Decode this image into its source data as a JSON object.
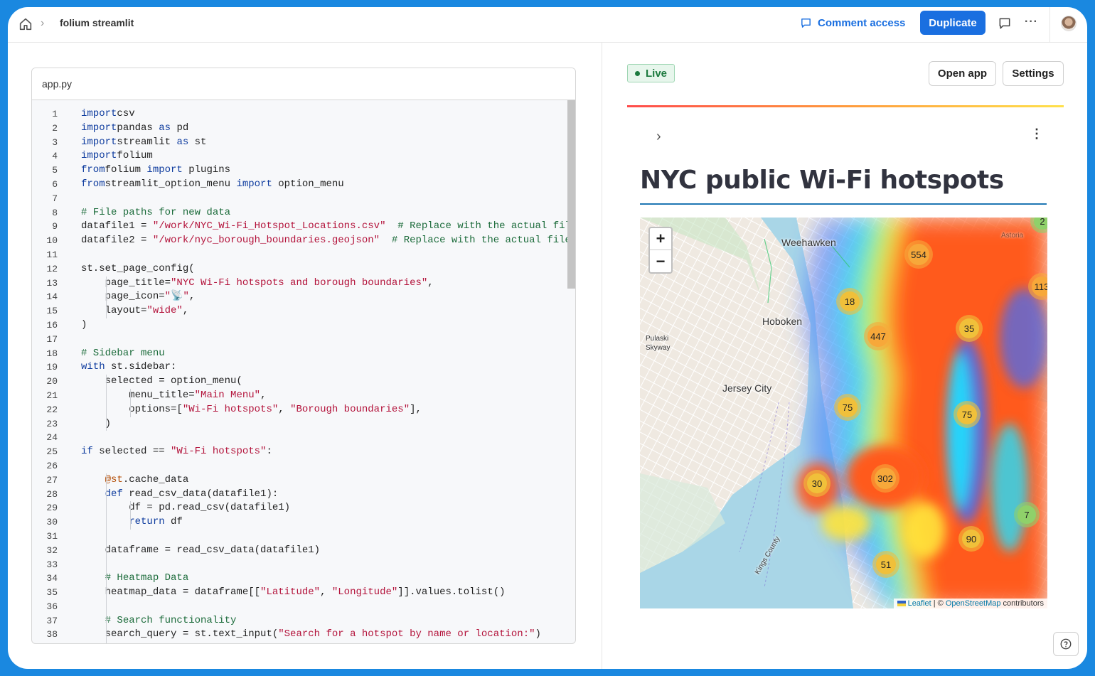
{
  "header": {
    "breadcrumb": "folium streamlit",
    "comment_access": "Comment access",
    "duplicate": "Duplicate"
  },
  "editor": {
    "filename": "app.py",
    "lines": [
      [
        [
          "kw",
          "import"
        ],
        [
          "",
          "csv"
        ]
      ],
      [
        [
          "kw",
          "import"
        ],
        [
          "",
          "pandas "
        ],
        [
          "kw",
          "as"
        ],
        [
          "",
          " pd"
        ]
      ],
      [
        [
          "kw",
          "import"
        ],
        [
          "",
          "streamlit "
        ],
        [
          "kw",
          "as"
        ],
        [
          "",
          " st"
        ]
      ],
      [
        [
          "kw",
          "import"
        ],
        [
          "",
          "folium"
        ]
      ],
      [
        [
          "kw",
          "from"
        ],
        [
          "",
          "folium "
        ],
        [
          "kw",
          "import"
        ],
        [
          "",
          " plugins"
        ]
      ],
      [
        [
          "kw",
          "from"
        ],
        [
          "",
          "streamlit_option_menu "
        ],
        [
          "kw",
          "import"
        ],
        [
          "",
          " option_menu"
        ]
      ],
      [],
      [
        [
          "com",
          "# File paths for new data"
        ]
      ],
      [
        [
          "",
          "datafile1 = "
        ],
        [
          "str",
          "\"/work/NYC_Wi-Fi_Hotspot_Locations.csv\""
        ],
        [
          "com",
          "  # Replace with the actual file path"
        ]
      ],
      [
        [
          "",
          "datafile2 = "
        ],
        [
          "str",
          "\"/work/nyc_borough_boundaries.geojson\""
        ],
        [
          "com",
          "  # Replace with the actual file path"
        ]
      ],
      [],
      [
        [
          "",
          "st.set_page_config("
        ]
      ],
      [
        [
          "",
          "    page_title="
        ],
        [
          "str",
          "\"NYC Wi-Fi hotspots and borough boundaries\""
        ],
        [
          "",
          ","
        ]
      ],
      [
        [
          "",
          "    page_icon="
        ],
        [
          "str",
          "\"📡\""
        ],
        [
          "",
          ","
        ]
      ],
      [
        [
          "",
          "    layout="
        ],
        [
          "str",
          "\"wide\""
        ],
        [
          "",
          ","
        ]
      ],
      [
        [
          "",
          ")"
        ]
      ],
      [],
      [
        [
          "com",
          "# Sidebar menu"
        ]
      ],
      [
        [
          "kw",
          "with"
        ],
        [
          "",
          " st.sidebar:"
        ]
      ],
      [
        [
          "",
          "    selected = option_menu("
        ]
      ],
      [
        [
          "",
          "        menu_title="
        ],
        [
          "str",
          "\"Main Menu\""
        ],
        [
          "",
          ","
        ]
      ],
      [
        [
          "",
          "        options=["
        ],
        [
          "str",
          "\"Wi-Fi hotspots\""
        ],
        [
          "",
          ", "
        ],
        [
          "str",
          "\"Borough boundaries\""
        ],
        [
          "",
          "],"
        ]
      ],
      [
        [
          "",
          "    )"
        ]
      ],
      [],
      [
        [
          "kw",
          "if"
        ],
        [
          "",
          " selected == "
        ],
        [
          "str",
          "\"Wi-Fi hotspots\""
        ],
        [
          "",
          ":"
        ]
      ],
      [],
      [
        [
          "",
          "    "
        ],
        [
          "dec",
          "@st"
        ],
        [
          "",
          ".cache_data"
        ]
      ],
      [
        [
          "",
          "    "
        ],
        [
          "kw",
          "def"
        ],
        [
          "",
          " read_csv_data(datafile1):"
        ]
      ],
      [
        [
          "",
          "        df = pd.read_csv(datafile1)"
        ]
      ],
      [
        [
          "",
          "        "
        ],
        [
          "kw",
          "return"
        ],
        [
          "",
          " df"
        ]
      ],
      [],
      [
        [
          "",
          "    dataframe = read_csv_data(datafile1)"
        ]
      ],
      [],
      [
        [
          "",
          "    "
        ],
        [
          "com",
          "# Heatmap Data"
        ]
      ],
      [
        [
          "",
          "    heatmap_data = dataframe[["
        ],
        [
          "str",
          "\"Latitude\""
        ],
        [
          "",
          ", "
        ],
        [
          "str",
          "\"Longitude\""
        ],
        [
          "",
          "]].values.tolist()"
        ]
      ],
      [],
      [
        [
          "",
          "    "
        ],
        [
          "com",
          "# Search functionality"
        ]
      ],
      [
        [
          "",
          "    search_query = st.text_input("
        ],
        [
          "str",
          "\"Search for a hotspot by name or location:\""
        ],
        [
          "",
          ")"
        ]
      ]
    ]
  },
  "preview": {
    "status": "Live",
    "open_app": "Open app",
    "settings": "Settings",
    "title": "NYC public Wi-Fi hotspots",
    "map": {
      "zoom_in": "+",
      "zoom_out": "−",
      "places": [
        "Weehawken",
        "Hoboken",
        "Jersey City",
        "Pulaski",
        "Skyway",
        "Kings County",
        "Astoria"
      ],
      "clusters": [
        "554",
        "18",
        "447",
        "35",
        "75",
        "75",
        "30",
        "302",
        "7",
        "90",
        "51",
        "113",
        "2"
      ],
      "attribution_leaflet": "Leaflet",
      "attribution_sep": " | © ",
      "attribution_osm": "OpenStreetMap",
      "attribution_tail": " contributors"
    }
  },
  "colors": {
    "accent": "#1a6fe0",
    "live_green": "#1c7a3e",
    "title_rule": "#1f77b4"
  }
}
